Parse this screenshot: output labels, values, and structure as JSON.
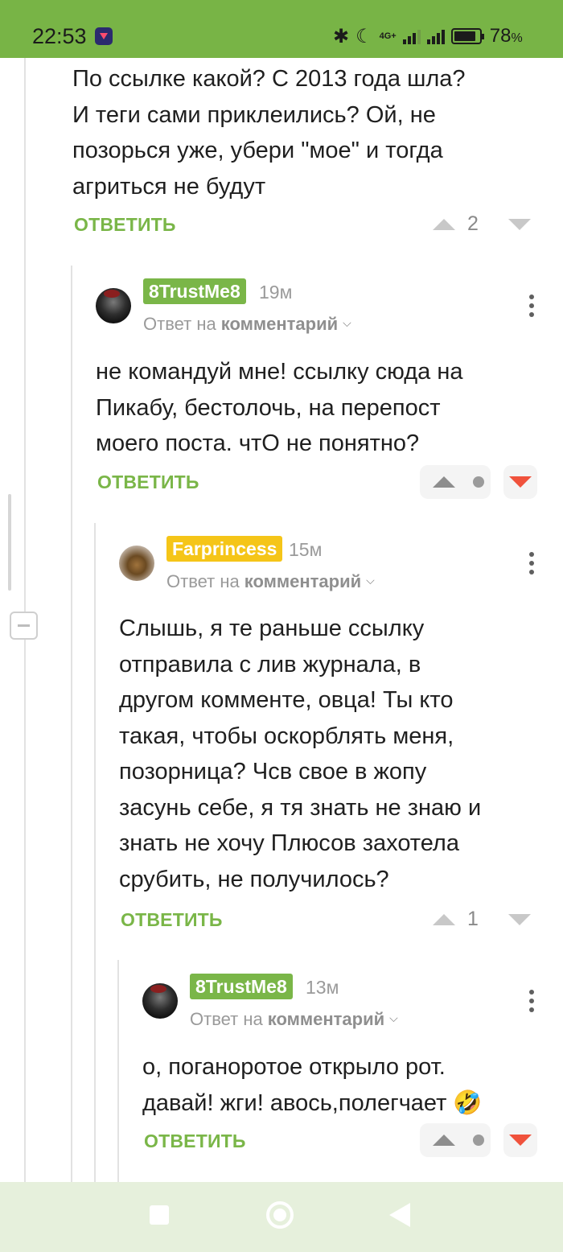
{
  "status_bar": {
    "time": "22:53",
    "network": "4G+",
    "battery_percent": "78",
    "battery_suffix": "%"
  },
  "comments": [
    {
      "text_lines": [
        "По ссылке какой? С 2013 года шла?",
        "И теги сами приклеились? Ой, не",
        "позорься уже, убери \"мое\" и тогда",
        "агриться не будут"
      ],
      "reply_label": "ОТВЕТИТЬ",
      "score": "2"
    },
    {
      "author": "8TrustMe8",
      "author_color": "#7ab648",
      "age": "19м",
      "reply_to_prefix": "Ответ на",
      "reply_to_target": "комментарий",
      "text_lines": [
        "не командуй мне! ссылку сюда на",
        "Пикабу, бестолочь, на перепост",
        "моего поста. чтО не понятно?"
      ],
      "reply_label": "ОТВЕТИТЬ",
      "score": ""
    },
    {
      "author": "Farprincess",
      "author_color": "#f5c518",
      "age": "15м",
      "reply_to_prefix": "Ответ на",
      "reply_to_target": "комментарий",
      "text_lines": [
        "Слышь, я те раньше ссылку",
        "отправила с лив журнала, в",
        "другом комменте, овца! Ты кто",
        "такая, чтобы оскорблять меня,",
        "позорница? Чсв свое в жопу",
        "засунь себе, я тя знать не знаю и",
        "знать не хочу Плюсов захотела",
        "срубить, не получилось?"
      ],
      "reply_label": "ОТВЕТИТЬ",
      "score": "1"
    },
    {
      "author": "8TrustMe8",
      "author_color": "#7ab648",
      "age": "13м",
      "reply_to_prefix": "Ответ на",
      "reply_to_target": "комментарий",
      "text_lines": [
        "о, поганоротое открыло рот.",
        "давай! жги! авось,полегчает 🤣"
      ],
      "reply_label": "ОТВЕТИТЬ",
      "score": ""
    }
  ],
  "icons": {
    "upvote": "triangle-up-icon",
    "downvote": "triangle-down-icon",
    "menu": "kebab-icon",
    "collapse": "minus-icon"
  }
}
